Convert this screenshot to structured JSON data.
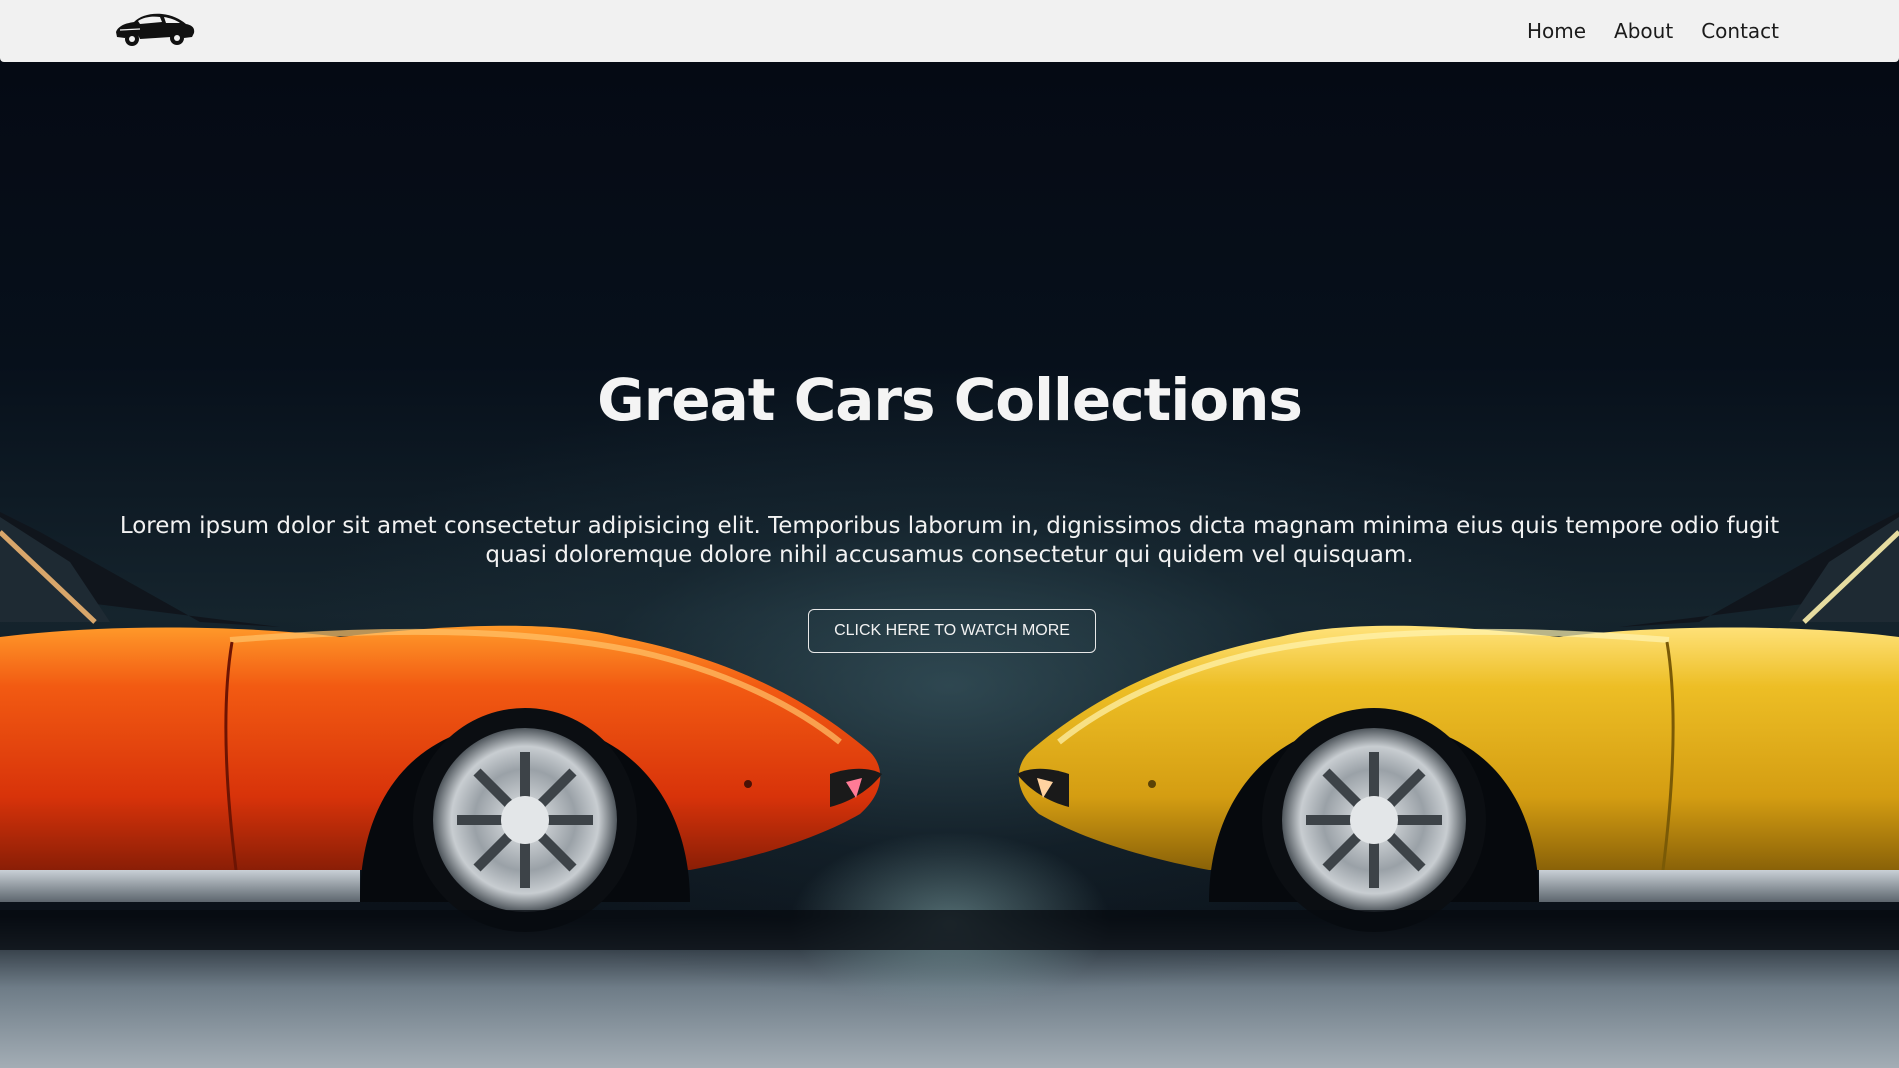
{
  "navbar": {
    "logo_icon": "car-logo-icon",
    "links": [
      {
        "label": "Home"
      },
      {
        "label": "About"
      },
      {
        "label": "Contact"
      }
    ]
  },
  "hero": {
    "title": "Great Cars Collections",
    "description": "Lorem ipsum dolor sit amet consectetur adipisicing elit. Temporibus laborum in, dignissimos dicta magnam minima eius quis tempore odio fugit quasi doloremque dolore nihil accusamus consectetur qui quidem vel quisquam.",
    "cta_label": "CLICK HERE TO WATCH MORE",
    "background_image": "two-sports-cars-facing-each-other",
    "colors": {
      "left_car": "#e8420f",
      "right_car": "#e2b218",
      "background": "#07101b",
      "navbar": "#f1f1f1"
    }
  }
}
